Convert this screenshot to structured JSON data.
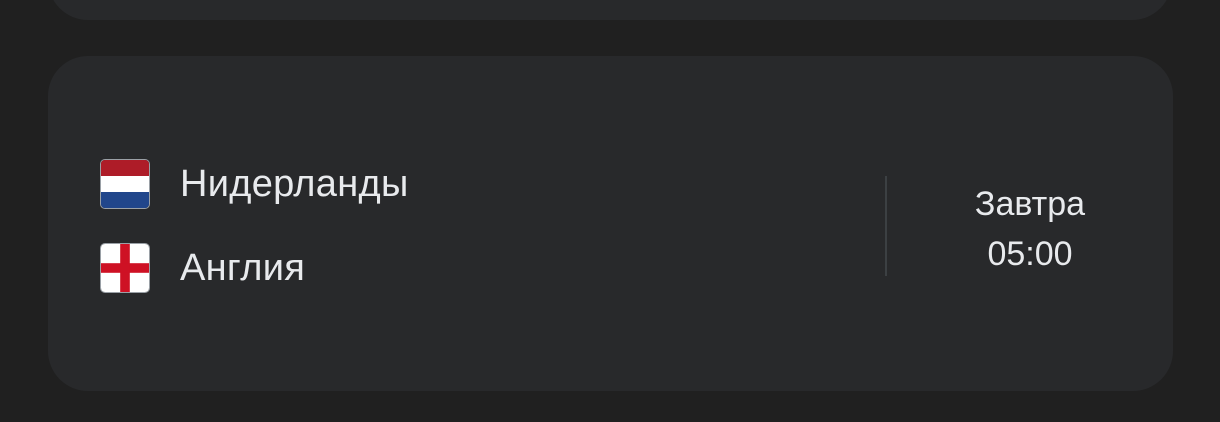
{
  "match": {
    "home_team": {
      "name": "Нидерланды",
      "flag": "netherlands-flag-icon"
    },
    "away_team": {
      "name": "Англия",
      "flag": "england-flag-icon"
    },
    "day": "Завтра",
    "time": "05:00"
  },
  "colors": {
    "background": "#202020",
    "card": "#28292b",
    "text": "#e8eaed",
    "divider": "#3c4043",
    "nl_red": "#ae1c28",
    "nl_white": "#ffffff",
    "nl_blue": "#21468b",
    "eng_red": "#ce1124"
  }
}
